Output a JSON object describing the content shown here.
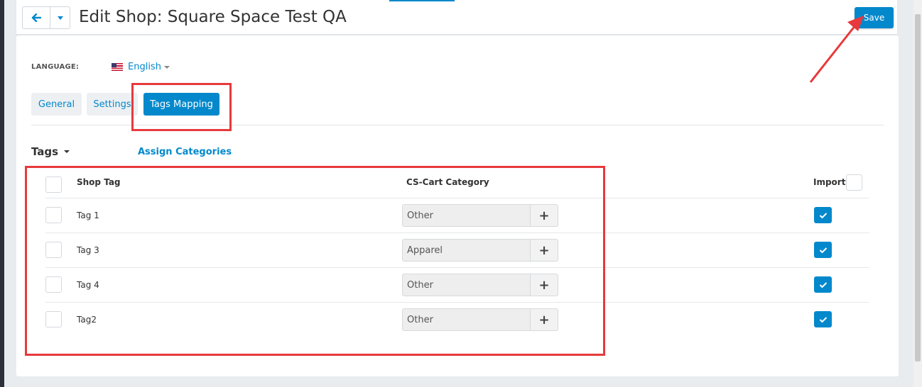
{
  "header": {
    "title": "Edit Shop: Square Space Test QA",
    "save_label": "Save",
    "back_icon": "arrow-left-icon",
    "dropdown_icon": "caret-down-icon"
  },
  "language": {
    "label": "LANGUAGE:",
    "value": "English",
    "flag_icon": "us-flag-icon"
  },
  "tabs": [
    {
      "label": "General",
      "active": false
    },
    {
      "label": "Settings",
      "active": false
    },
    {
      "label": "Tags Mapping",
      "active": true
    }
  ],
  "section": {
    "title": "Tags",
    "assign_link": "Assign Categories"
  },
  "table": {
    "columns": {
      "shop_tag": "Shop Tag",
      "category": "CS-Cart Category",
      "import": "Import"
    },
    "rows": [
      {
        "tag": "Tag 1",
        "category": "Other",
        "import": true
      },
      {
        "tag": "Tag 3",
        "category": "Apparel",
        "import": true
      },
      {
        "tag": "Tag 4",
        "category": "Other",
        "import": true
      },
      {
        "tag": "Tag2",
        "category": "Other",
        "import": true
      }
    ],
    "add_icon": "plus-icon",
    "check_icon": "checkmark-icon"
  },
  "colors": {
    "accent": "#0388cc",
    "annotation": "#e8393c"
  }
}
